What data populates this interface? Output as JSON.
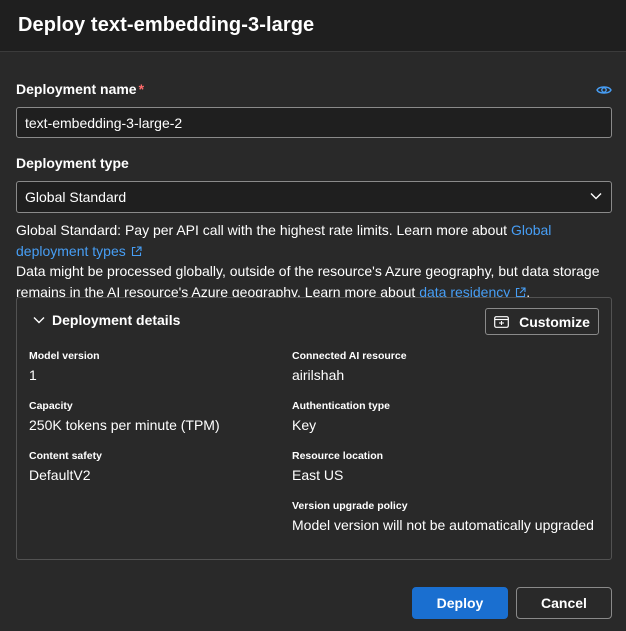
{
  "dialog": {
    "title": "Deploy text-embedding-3-large"
  },
  "form": {
    "name_label": "Deployment name",
    "required_mark": "*",
    "name_value": "text-embedding-3-large-2",
    "type_label": "Deployment type",
    "type_value": "Global Standard",
    "desc1_text": "Global Standard: Pay per API call with the highest rate limits. Learn more about ",
    "desc1_link": "Global deployment types",
    "desc2_text": "Data might be processed globally, outside of the resource's Azure geography, but data storage remains in the AI resource's Azure geography. Learn more about ",
    "desc2_link": "data residency",
    "desc2_end": "."
  },
  "details": {
    "header": "Deployment details",
    "customize_label": "Customize",
    "fields": [
      {
        "label": "Model version",
        "value": "1"
      },
      {
        "label": "Connected AI resource",
        "value": "airilshah"
      },
      {
        "label": "Capacity",
        "value": "250K tokens per minute (TPM)"
      },
      {
        "label": "Authentication type",
        "value": "Key"
      },
      {
        "label": "Content safety",
        "value": "DefaultV2"
      },
      {
        "label": "Resource location",
        "value": "East US"
      },
      {
        "label": "Version upgrade policy",
        "value": "Model version will not be automatically upgraded"
      }
    ]
  },
  "footer": {
    "deploy_label": "Deploy",
    "cancel_label": "Cancel"
  },
  "icons": {
    "eye": "eye-icon",
    "chevron": "chevron-down-icon",
    "external": "external-link-icon",
    "customize": "customize-icon"
  },
  "colors": {
    "accent": "#1a6fd0",
    "link": "#479ef5",
    "required": "#ff6b6b",
    "background": "#292929"
  }
}
